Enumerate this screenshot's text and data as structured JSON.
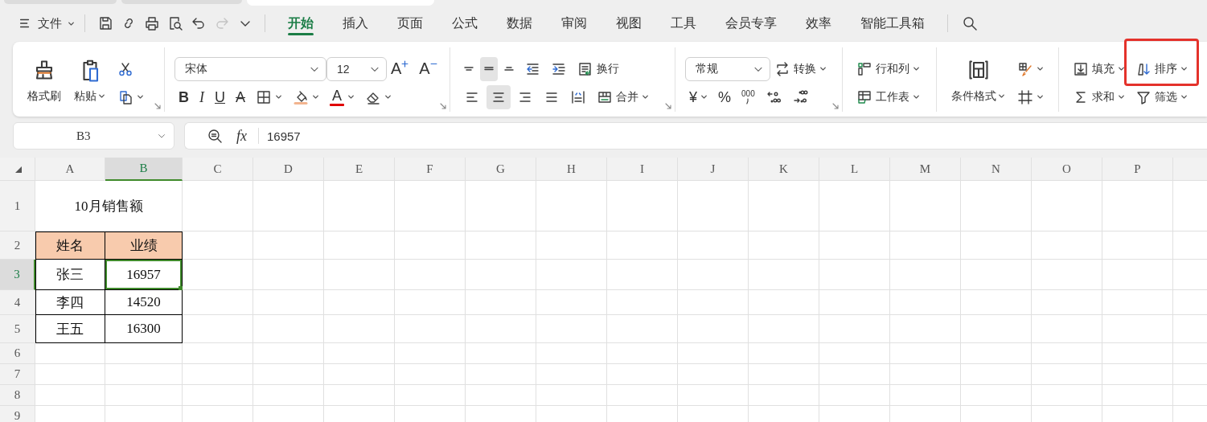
{
  "document_tabs": [
    {
      "selected": false
    },
    {
      "selected": false
    },
    {
      "selected": true
    }
  ],
  "file_menu": "文件",
  "quick_access": [
    {
      "disabled": false
    },
    {
      "disabled": false
    },
    {
      "disabled": false
    },
    {
      "disabled": false
    },
    {
      "disabled": false
    },
    {
      "disabled": true
    },
    {
      "disabled": false
    }
  ],
  "tabs": [
    {
      "label": "开始",
      "selected": true
    },
    {
      "label": "插入",
      "selected": false
    },
    {
      "label": "页面",
      "selected": false
    },
    {
      "label": "公式",
      "selected": false
    },
    {
      "label": "数据",
      "selected": false
    },
    {
      "label": "审阅",
      "selected": false
    },
    {
      "label": "视图",
      "selected": false
    },
    {
      "label": "工具",
      "selected": false
    },
    {
      "label": "会员专享",
      "selected": false
    },
    {
      "label": "效率",
      "selected": false
    },
    {
      "label": "智能工具箱",
      "selected": false
    }
  ],
  "ribbon": {
    "groups": [
      {
        "launcher": true,
        "large": [
          {
            "kind": "large",
            "label": "格式刷"
          },
          {
            "kind": "large",
            "label": "粘贴",
            "dropdown": true
          }
        ],
        "top_row": [
          {
            "kind": "icon"
          }
        ],
        "bottom_row": [
          {
            "kind": "icon",
            "dropdown": true
          }
        ]
      },
      {
        "launcher": true,
        "top_row": [
          {
            "kind": "select",
            "value": "宋体"
          },
          {
            "kind": "select",
            "value": "12"
          },
          {
            "kind": "grow",
            "text": "A"
          },
          {
            "kind": "shrink",
            "text": "A"
          }
        ],
        "bottom_row": [
          {
            "kind": "bold",
            "text": "B"
          },
          {
            "kind": "italic",
            "text": "I"
          },
          {
            "kind": "underline",
            "text": "U"
          },
          {
            "kind": "strike",
            "text": "A"
          },
          {
            "kind": "icon",
            "dropdown": true
          },
          {
            "kind": "icon",
            "dropdown": true
          },
          {
            "kind": "color",
            "text": "A",
            "dropdown": true
          },
          {
            "kind": "icon",
            "dropdown": true
          }
        ]
      },
      {
        "launcher": true,
        "top_row": [
          {
            "kind": "icon",
            "selected": false
          },
          {
            "kind": "icon",
            "selected": true
          },
          {
            "kind": "icon",
            "selected": false
          },
          {
            "kind": "icon",
            "selected": false
          },
          {
            "kind": "icon",
            "selected": false
          },
          {
            "kind": "small",
            "label": "换行",
            "selected": false
          }
        ],
        "bottom_row": [
          {
            "kind": "icon",
            "selected": false
          },
          {
            "kind": "icon",
            "selected": true
          },
          {
            "kind": "icon",
            "selected": false
          },
          {
            "kind": "icon",
            "selected": false
          },
          {
            "kind": "icon",
            "selected": false
          },
          {
            "kind": "small",
            "label": "合并",
            "dropdown": true,
            "selected": false
          }
        ]
      },
      {
        "launcher": true,
        "top_row": [
          {
            "kind": "select",
            "value": "常规"
          },
          {
            "kind": "small",
            "label": "转换",
            "dropdown": true
          }
        ],
        "bottom_row": [
          {
            "kind": "currency",
            "text": "¥",
            "dropdown": true
          },
          {
            "kind": "percent",
            "text": "%"
          },
          {
            "kind": "thousands",
            "text": "000"
          },
          {
            "kind": "icon"
          },
          {
            "kind": "icon"
          }
        ]
      },
      {
        "top_row": [
          {
            "kind": "small",
            "label": "行和列",
            "dropdown": true
          }
        ],
        "bottom_row": [
          {
            "kind": "small",
            "label": "工作表",
            "dropdown": true
          }
        ]
      },
      {
        "large": [
          {
            "kind": "large",
            "label": "条件格式",
            "dropdown": true
          }
        ],
        "top_row": [
          {
            "kind": "icon",
            "dropdown": true
          }
        ],
        "bottom_row": [
          {
            "kind": "icon",
            "dropdown": true
          }
        ]
      },
      {
        "top_row": [
          {
            "kind": "small",
            "label": "填充",
            "dropdown": true,
            "highlighted": false
          },
          {
            "kind": "small",
            "label": "排序",
            "dropdown": true,
            "highlighted": true
          }
        ],
        "bottom_row": [
          {
            "kind": "small",
            "label": "求和",
            "dropdown": true,
            "highlighted": false
          },
          {
            "kind": "small",
            "label": "筛选",
            "dropdown": true,
            "highlighted": false
          }
        ]
      }
    ]
  },
  "formula_bar": {
    "cell_ref": "B3",
    "fx": "fx",
    "value": "16957"
  },
  "sheet": {
    "columns": [
      {
        "label": "A",
        "selected": false
      },
      {
        "label": "B",
        "selected": true
      },
      {
        "label": "C",
        "selected": false
      },
      {
        "label": "D",
        "selected": false
      },
      {
        "label": "E",
        "selected": false
      },
      {
        "label": "F",
        "selected": false
      },
      {
        "label": "G",
        "selected": false
      },
      {
        "label": "H",
        "selected": false
      },
      {
        "label": "I",
        "selected": false
      },
      {
        "label": "J",
        "selected": false
      },
      {
        "label": "K",
        "selected": false
      },
      {
        "label": "L",
        "selected": false
      },
      {
        "label": "M",
        "selected": false
      },
      {
        "label": "N",
        "selected": false
      },
      {
        "label": "O",
        "selected": false
      },
      {
        "label": "P",
        "selected": false
      }
    ],
    "rows": [
      {
        "label": "1",
        "selected": false,
        "kind": "title",
        "cells": [
          {
            "text": "10月销售额",
            "merged": true,
            "selected": false
          }
        ]
      },
      {
        "label": "2",
        "selected": false,
        "kind": "header",
        "cells": [
          {
            "text": "姓名",
            "selected": false
          },
          {
            "text": "业绩",
            "selected": false
          }
        ]
      },
      {
        "label": "3",
        "selected": true,
        "kind": "data",
        "cells": [
          {
            "text": "张三",
            "selected": false
          },
          {
            "text": "16957",
            "selected": true
          }
        ]
      },
      {
        "label": "4",
        "selected": false,
        "kind": "data",
        "cells": [
          {
            "text": "李四",
            "selected": false
          },
          {
            "text": "14520",
            "selected": false
          }
        ]
      },
      {
        "label": "5",
        "selected": false,
        "kind": "data",
        "cells": [
          {
            "text": "王五",
            "selected": false
          },
          {
            "text": "16300",
            "selected": false
          }
        ]
      },
      {
        "label": "6",
        "selected": false
      },
      {
        "label": "7",
        "selected": false
      },
      {
        "label": "8",
        "selected": false
      },
      {
        "label": "9",
        "selected": false
      }
    ]
  }
}
